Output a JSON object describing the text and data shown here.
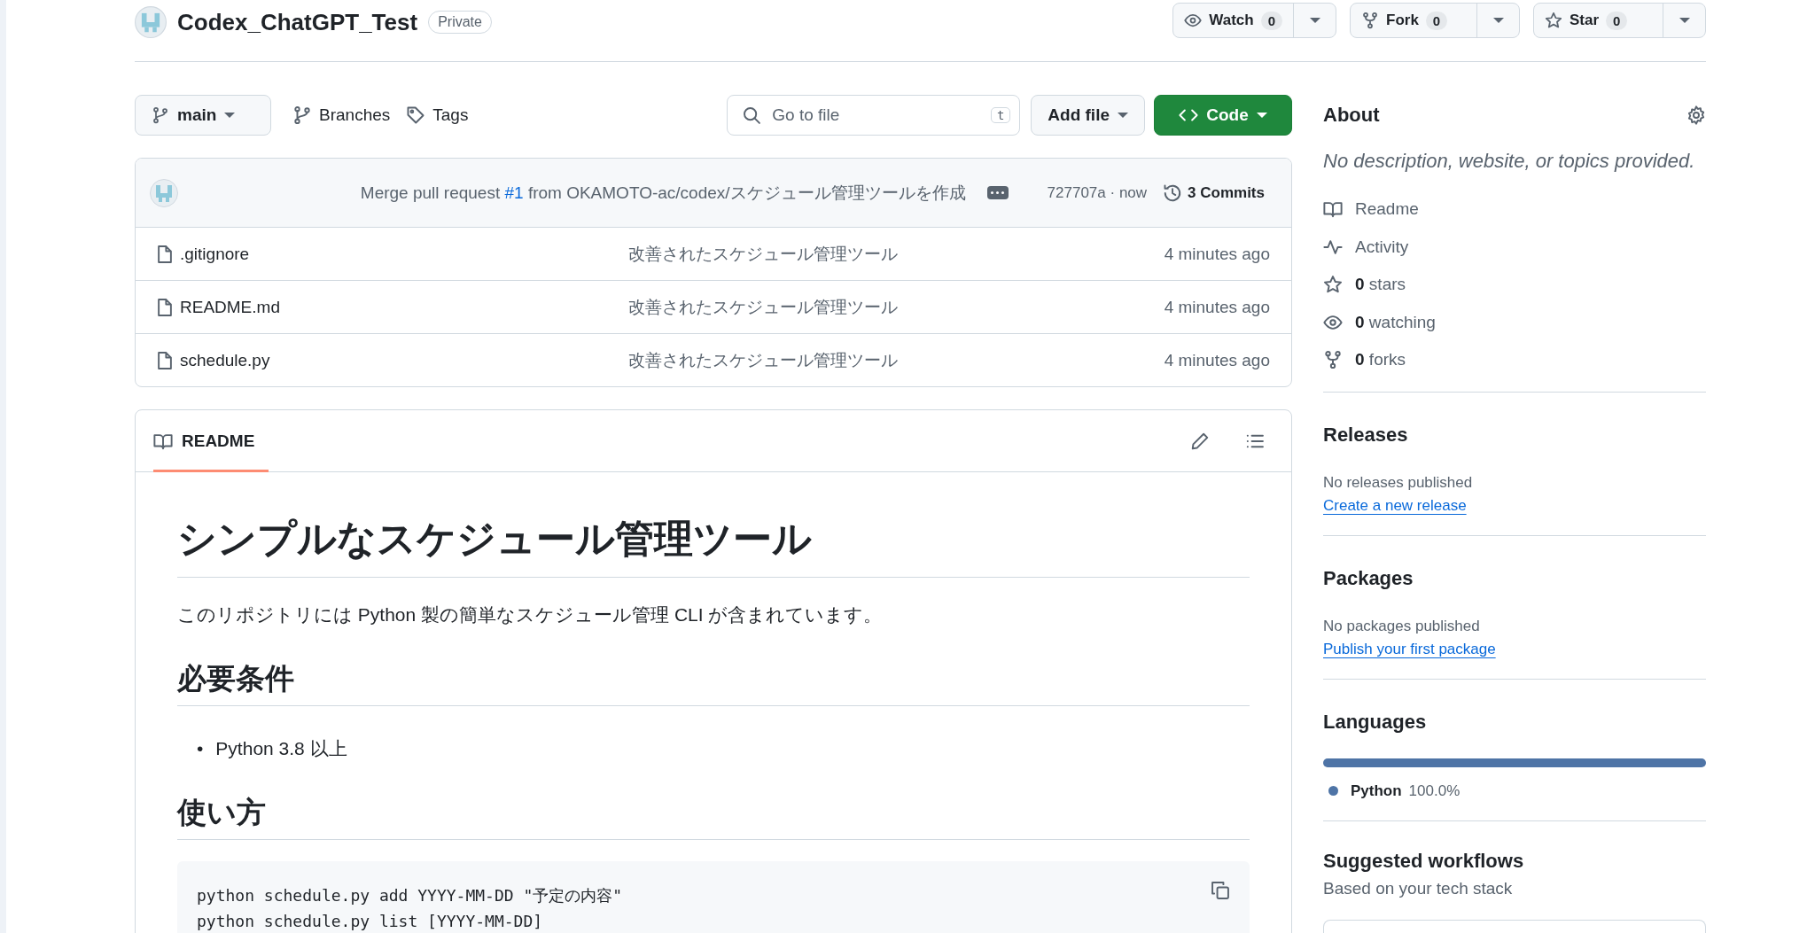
{
  "repo": {
    "name": "Codex_ChatGPT_Test",
    "visibility": "Private"
  },
  "header_actions": [
    {
      "kind": "watch",
      "label": "Watch",
      "count": "0"
    },
    {
      "kind": "fork",
      "label": "Fork",
      "count": "0"
    },
    {
      "kind": "star",
      "label": "Star",
      "count": "0"
    }
  ],
  "toolbar": {
    "branch": "main",
    "links": [
      {
        "kind": "branches",
        "label": "Branches"
      },
      {
        "kind": "tags",
        "label": "Tags"
      }
    ],
    "search": {
      "placeholder": "Go to file",
      "shortcut": "t"
    },
    "add_file": "Add file",
    "code": "Code"
  },
  "latest_commit": {
    "message_before": "Merge pull request ",
    "pr": "#1",
    "message_after": " from OKAMOTO-ac/codex/スケジュール管理ツールを作成",
    "hash_time": "727707a · now",
    "commits": "3 Commits"
  },
  "files": [
    {
      "name": ".gitignore",
      "message": "改善されたスケジュール管理ツール",
      "time": "4 minutes ago"
    },
    {
      "name": "README.md",
      "message": "改善されたスケジュール管理ツール",
      "time": "4 minutes ago"
    },
    {
      "name": "schedule.py",
      "message": "改善されたスケジュール管理ツール",
      "time": "4 minutes ago"
    }
  ],
  "readme": {
    "tab": "README",
    "blocks": [
      {
        "kind": "h1",
        "text": "シンプルなスケジュール管理ツール"
      },
      {
        "kind": "p",
        "text": "このリポジトリには Python 製の簡単なスケジュール管理 CLI が含まれています。"
      },
      {
        "kind": "h2",
        "text": "必要条件"
      },
      {
        "kind": "list",
        "marker": "•",
        "items": [
          "Python 3.8 以上"
        ]
      },
      {
        "kind": "h2",
        "text": "使い方"
      },
      {
        "kind": "code",
        "lines": [
          "python schedule.py add YYYY-MM-DD \"予定の内容\"",
          "python schedule.py list [YYYY-MM-DD]"
        ]
      }
    ]
  },
  "sidebar": {
    "about": {
      "title": "About",
      "description": "No description, website, or topics provided.",
      "links": [
        {
          "kind": "readme",
          "text": "Readme"
        },
        {
          "kind": "activity",
          "text": "Activity"
        },
        {
          "kind": "stars",
          "text": "**0** stars"
        },
        {
          "kind": "watching",
          "text": "**0** watching"
        },
        {
          "kind": "forks",
          "text": "**0** forks"
        }
      ]
    },
    "releases": {
      "title": "Releases",
      "text": "No releases published",
      "link": "Create a new release"
    },
    "packages": {
      "title": "Packages",
      "text": "No packages published",
      "link": "Publish your first package"
    },
    "languages": {
      "title": "Languages",
      "items": [
        {
          "name": "Python",
          "percent": "100.0%",
          "color": "#4e74a6",
          "level": 1
        }
      ]
    },
    "suggested": {
      "title": "Suggested workflows",
      "subtitle": "Based on your tech stack"
    }
  }
}
